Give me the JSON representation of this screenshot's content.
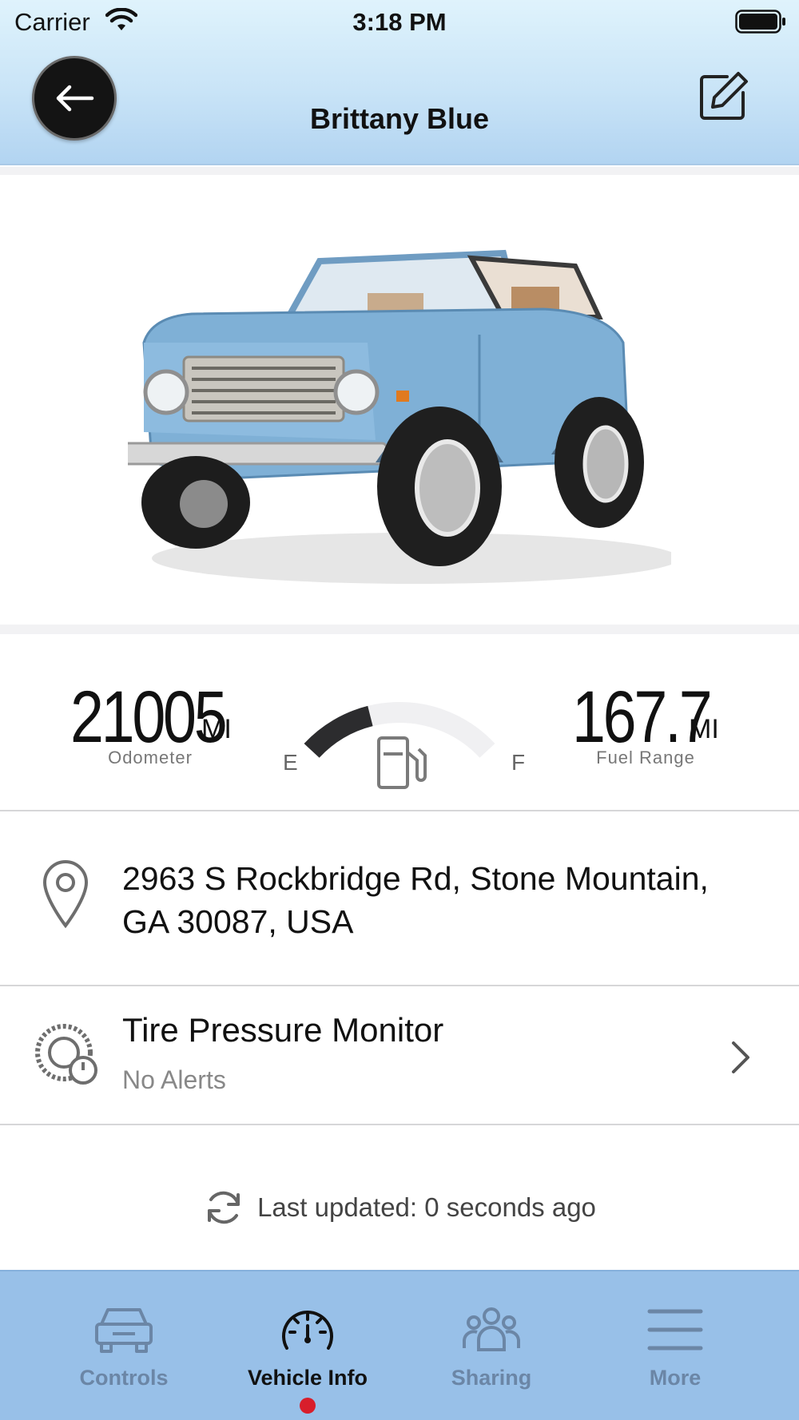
{
  "status_bar": {
    "carrier": "Carrier",
    "time": "3:18 PM"
  },
  "header": {
    "title": "Brittany Blue"
  },
  "vehicle": {
    "color": "#7fb0d6"
  },
  "stats": {
    "odometer": {
      "value": "21005",
      "unit": "MI",
      "label": "Odometer"
    },
    "fuel_range": {
      "value": "167.7",
      "unit": "MI",
      "label": "Fuel Range"
    },
    "fuel_gauge": {
      "empty_label": "E",
      "full_label": "F",
      "fill_fraction": 0.35
    }
  },
  "location": {
    "address": "2963 S Rockbridge Rd, Stone Mountain, GA 30087, USA"
  },
  "tire_pressure": {
    "title": "Tire Pressure Monitor",
    "status": "No Alerts"
  },
  "last_updated": "Last updated: 0 seconds ago",
  "tabs": [
    {
      "label": "Controls",
      "icon": "car-icon",
      "active": false
    },
    {
      "label": "Vehicle Info",
      "icon": "speedometer-icon",
      "active": true
    },
    {
      "label": "Sharing",
      "icon": "people-icon",
      "active": false
    },
    {
      "label": "More",
      "icon": "menu-icon",
      "active": false
    }
  ],
  "colors": {
    "header_bg": "#c9e4f7",
    "tab_bar_bg": "#98c0e8",
    "active_dot": "#d81e2b",
    "inactive_tab": "#6b86a6"
  }
}
